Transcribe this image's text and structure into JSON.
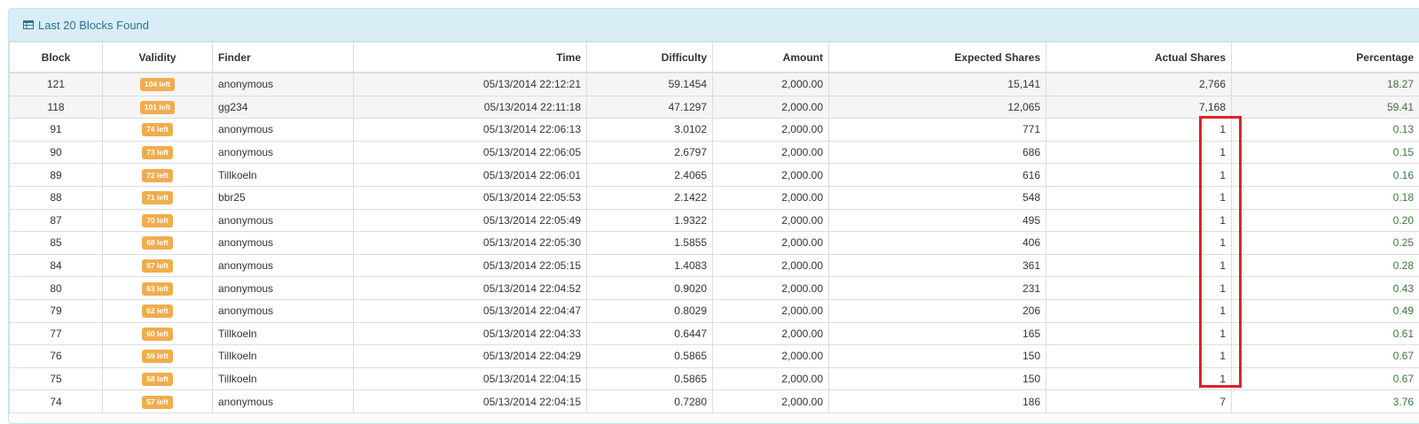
{
  "panel": {
    "title": "Last 20 Blocks Found"
  },
  "columns": {
    "block": "Block",
    "validity": "Validity",
    "finder": "Finder",
    "time": "Time",
    "difficulty": "Difficulty",
    "amount": "Amount",
    "expected": "Expected Shares",
    "actual": "Actual Shares",
    "percentage": "Percentage"
  },
  "rows": [
    {
      "block": "121",
      "validity": "104 left",
      "finder": "anonymous",
      "time": "05/13/2014 22:12:21",
      "difficulty": "59.1454",
      "amount": "2,000.00",
      "expected": "15,141",
      "actual": "2,766",
      "percentage": "18.27"
    },
    {
      "block": "118",
      "validity": "101 left",
      "finder": "gg234",
      "time": "05/13/2014 22:11:18",
      "difficulty": "47.1297",
      "amount": "2,000.00",
      "expected": "12,065",
      "actual": "7,168",
      "percentage": "59.41"
    },
    {
      "block": "91",
      "validity": "74 left",
      "finder": "anonymous",
      "time": "05/13/2014 22:06:13",
      "difficulty": "3.0102",
      "amount": "2,000.00",
      "expected": "771",
      "actual": "1",
      "percentage": "0.13"
    },
    {
      "block": "90",
      "validity": "73 left",
      "finder": "anonymous",
      "time": "05/13/2014 22:06:05",
      "difficulty": "2.6797",
      "amount": "2,000.00",
      "expected": "686",
      "actual": "1",
      "percentage": "0.15"
    },
    {
      "block": "89",
      "validity": "72 left",
      "finder": "Tillkoeln",
      "time": "05/13/2014 22:06:01",
      "difficulty": "2.4065",
      "amount": "2,000.00",
      "expected": "616",
      "actual": "1",
      "percentage": "0.16"
    },
    {
      "block": "88",
      "validity": "71 left",
      "finder": "bbr25",
      "time": "05/13/2014 22:05:53",
      "difficulty": "2.1422",
      "amount": "2,000.00",
      "expected": "548",
      "actual": "1",
      "percentage": "0.18"
    },
    {
      "block": "87",
      "validity": "70 left",
      "finder": "anonymous",
      "time": "05/13/2014 22:05:49",
      "difficulty": "1.9322",
      "amount": "2,000.00",
      "expected": "495",
      "actual": "1",
      "percentage": "0.20"
    },
    {
      "block": "85",
      "validity": "68 left",
      "finder": "anonymous",
      "time": "05/13/2014 22:05:30",
      "difficulty": "1.5855",
      "amount": "2,000.00",
      "expected": "406",
      "actual": "1",
      "percentage": "0.25"
    },
    {
      "block": "84",
      "validity": "67 left",
      "finder": "anonymous",
      "time": "05/13/2014 22:05:15",
      "difficulty": "1.4083",
      "amount": "2,000.00",
      "expected": "361",
      "actual": "1",
      "percentage": "0.28"
    },
    {
      "block": "80",
      "validity": "63 left",
      "finder": "anonymous",
      "time": "05/13/2014 22:04:52",
      "difficulty": "0.9020",
      "amount": "2,000.00",
      "expected": "231",
      "actual": "1",
      "percentage": "0.43"
    },
    {
      "block": "79",
      "validity": "62 left",
      "finder": "anonymous",
      "time": "05/13/2014 22:04:47",
      "difficulty": "0.8029",
      "amount": "2,000.00",
      "expected": "206",
      "actual": "1",
      "percentage": "0.49"
    },
    {
      "block": "77",
      "validity": "60 left",
      "finder": "Tillkoeln",
      "time": "05/13/2014 22:04:33",
      "difficulty": "0.6447",
      "amount": "2,000.00",
      "expected": "165",
      "actual": "1",
      "percentage": "0.61"
    },
    {
      "block": "76",
      "validity": "59 left",
      "finder": "Tillkoeln",
      "time": "05/13/2014 22:04:29",
      "difficulty": "0.5865",
      "amount": "2,000.00",
      "expected": "150",
      "actual": "1",
      "percentage": "0.67"
    },
    {
      "block": "75",
      "validity": "58 left",
      "finder": "Tillkoeln",
      "time": "05/13/2014 22:04:15",
      "difficulty": "0.5865",
      "amount": "2,000.00",
      "expected": "150",
      "actual": "1",
      "percentage": "0.67"
    },
    {
      "block": "74",
      "validity": "57 left",
      "finder": "anonymous",
      "time": "05/13/2014 22:04:15",
      "difficulty": "0.7280",
      "amount": "2,000.00",
      "expected": "186",
      "actual": "7",
      "percentage": "3.76"
    }
  ],
  "colors": {
    "badge": "#f0ad4e",
    "percentage": "#3c763d",
    "highlight": "#d9232e",
    "heading_bg": "#d9edf7"
  },
  "icons": {
    "panel": "table-icon"
  }
}
